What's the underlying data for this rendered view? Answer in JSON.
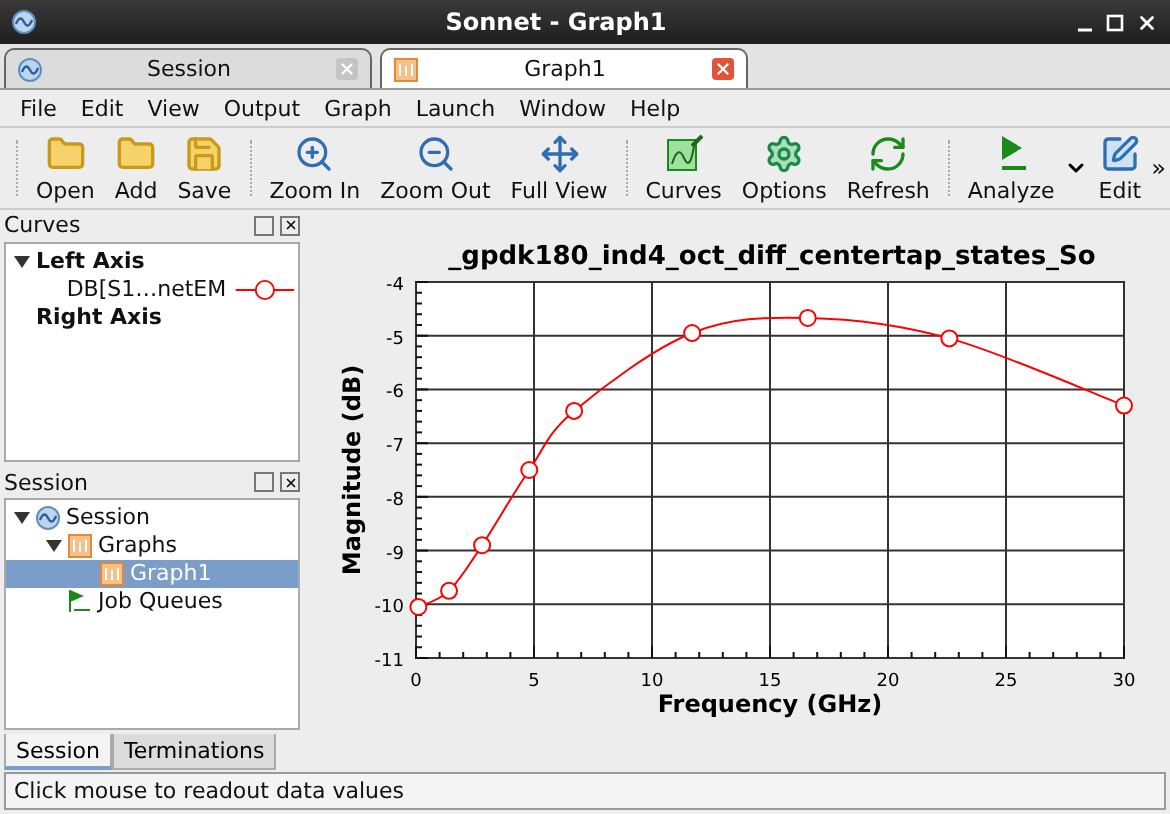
{
  "window": {
    "title": "Sonnet - Graph1"
  },
  "doc_tabs": [
    {
      "label": "Session",
      "kind": "session",
      "selected": false
    },
    {
      "label": "Graph1",
      "kind": "graph",
      "selected": true
    }
  ],
  "menu": [
    "File",
    "Edit",
    "View",
    "Output",
    "Graph",
    "Launch",
    "Window",
    "Help"
  ],
  "toolbar": [
    [
      {
        "label": "Open",
        "kind": "open"
      },
      {
        "label": "Add",
        "kind": "add"
      },
      {
        "label": "Save",
        "kind": "save"
      }
    ],
    [
      {
        "label": "Zoom In",
        "kind": "zoom_in"
      },
      {
        "label": "Zoom Out",
        "kind": "zoom_out"
      },
      {
        "label": "Full View",
        "kind": "full_view"
      }
    ],
    [
      {
        "label": "Curves",
        "kind": "curves"
      },
      {
        "label": "Options",
        "kind": "options"
      },
      {
        "label": "Refresh",
        "kind": "refresh"
      }
    ],
    [
      {
        "label": "Analyze",
        "kind": "analyze",
        "menu_arrow": true
      },
      {
        "label": "Edit",
        "kind": "edit"
      }
    ]
  ],
  "overflow": "»",
  "curves_panel": {
    "title": "Curves",
    "tree": [
      {
        "label": "Left Axis",
        "kind": "axis",
        "expanded": true,
        "children": [
          {
            "label": "DB[S1…netEM",
            "color": "#ff0000"
          }
        ]
      },
      {
        "label": "Right Axis",
        "kind": "axis"
      }
    ]
  },
  "session_panel": {
    "title": "Session",
    "tree": [
      {
        "label": "Session",
        "kind": "session",
        "selected": false,
        "expanded": true,
        "children": [
          {
            "label": "Graphs",
            "kind": "graphs",
            "selected": false,
            "expanded": true,
            "children": [
              {
                "label": "Graph1",
                "kind": "graph",
                "selected": true
              }
            ]
          },
          {
            "label": "Job Queues",
            "kind": "jobs",
            "selected": false
          }
        ]
      }
    ]
  },
  "panel_tabs": [
    {
      "label": "Session",
      "selected": true
    },
    {
      "label": "Terminations",
      "selected": false
    }
  ],
  "graph": {
    "chart_data": {
      "type": "line",
      "title": "_gpdk180_ind4_oct_diff_centertap_states_So",
      "xlabel": "Frequency (GHz)",
      "ylabel": "Magnitude (dB)",
      "x": [
        0.1,
        1.4,
        2.8,
        4.8,
        6.7,
        11.7,
        16.6,
        22.6,
        30
      ],
      "grid": true,
      "series": [
        {
          "color": "#ff0000",
          "marker": "circle",
          "values": [
            -10.05,
            -9.75,
            -8.9,
            -7.5,
            -6.4,
            -4.95,
            -4.67,
            -5.05,
            -6.3
          ]
        }
      ],
      "xlim": [
        0,
        30
      ],
      "ylim": [
        -11,
        -4
      ],
      "xticks": [
        0,
        5,
        10,
        15,
        20,
        25,
        30
      ],
      "yticks": [
        -11,
        -10,
        -9,
        -8,
        -7,
        -6,
        -5,
        -4
      ]
    }
  },
  "status_bar": "Click mouse to readout data values"
}
